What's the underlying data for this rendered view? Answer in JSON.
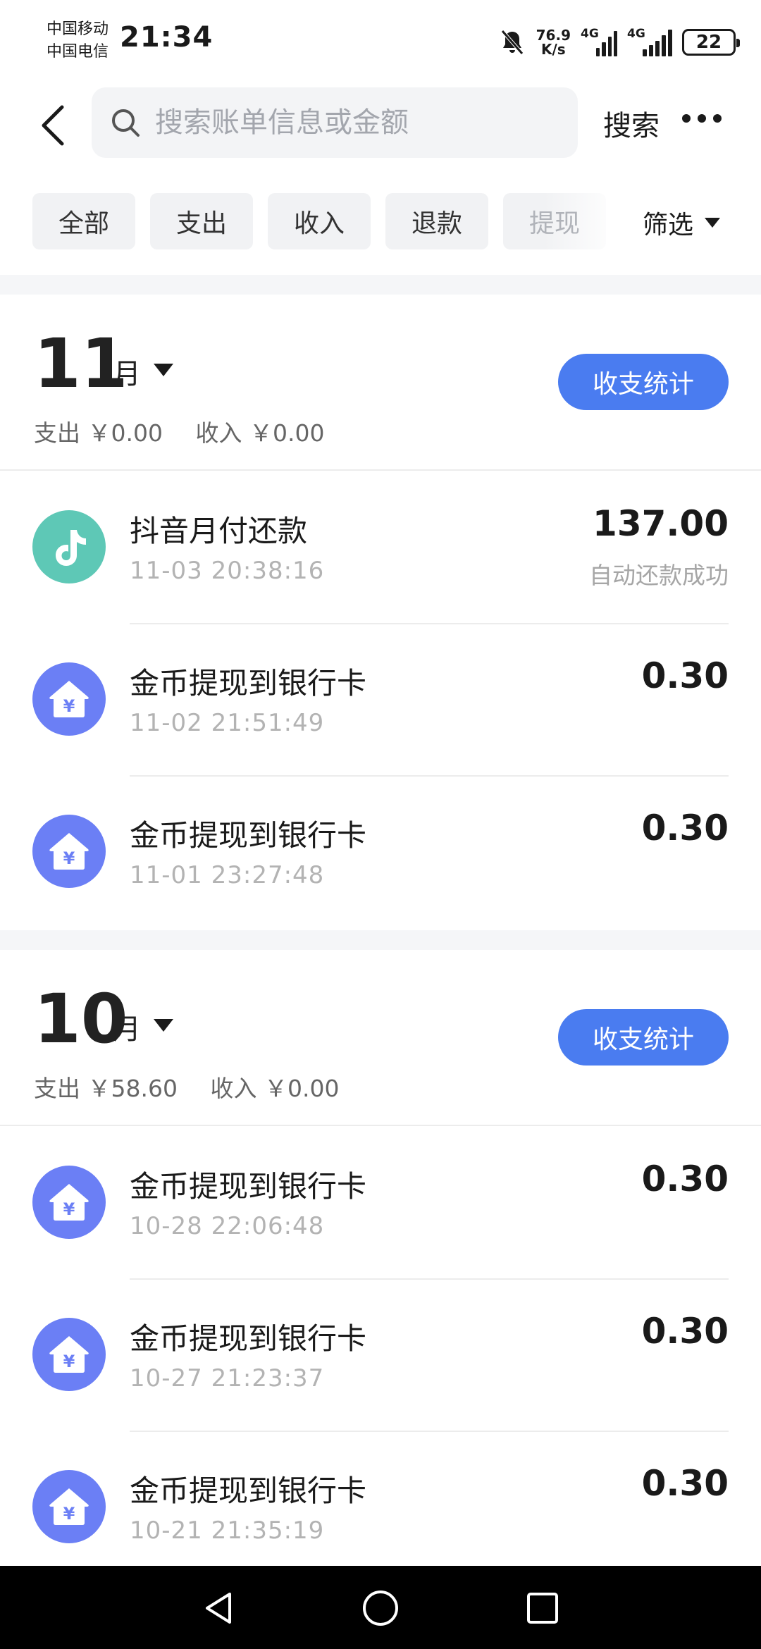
{
  "status": {
    "carrier1": "中国移动",
    "carrier2": "中国电信",
    "time": "21:34",
    "net_speed_value": "76.9",
    "net_speed_unit": "K/s",
    "signal1": "4G",
    "signal2": "4G",
    "battery": "22"
  },
  "header": {
    "search_placeholder": "搜索账单信息或金额",
    "search_label": "搜索"
  },
  "tabs": [
    {
      "label": "全部"
    },
    {
      "label": "支出"
    },
    {
      "label": "收入"
    },
    {
      "label": "退款"
    },
    {
      "label": "提现"
    }
  ],
  "filter_label": "筛选",
  "months": [
    {
      "number": "11",
      "unit": "月",
      "expense_label": "支出",
      "expense": "￥0.00",
      "income_label": "收入",
      "income": "￥0.00",
      "stats_label": "收支统计",
      "transactions": [
        {
          "title": "抖音月付还款",
          "time": "11-03 20:38:16",
          "amount": "137.00",
          "note": "自动还款成功",
          "icon": "douyin-icon",
          "color": "#5ec8b6"
        },
        {
          "title": "金币提现到银行卡",
          "time": "11-02 21:51:49",
          "amount": "0.30",
          "note": "",
          "icon": "coin-house-icon",
          "color": "#6b7ff5"
        },
        {
          "title": "金币提现到银行卡",
          "time": "11-01 23:27:48",
          "amount": "0.30",
          "note": "",
          "icon": "coin-house-icon",
          "color": "#6b7ff5"
        }
      ]
    },
    {
      "number": "10",
      "unit": "月",
      "expense_label": "支出",
      "expense": "￥58.60",
      "income_label": "收入",
      "income": "￥0.00",
      "stats_label": "收支统计",
      "transactions": [
        {
          "title": "金币提现到银行卡",
          "time": "10-28 22:06:48",
          "amount": "0.30",
          "note": "",
          "icon": "coin-house-icon",
          "color": "#6b7ff5"
        },
        {
          "title": "金币提现到银行卡",
          "time": "10-27 21:23:37",
          "amount": "0.30",
          "note": "",
          "icon": "coin-house-icon",
          "color": "#6b7ff5"
        },
        {
          "title": "金币提现到银行卡",
          "time": "10-21 21:35:19",
          "amount": "0.30",
          "note": "",
          "icon": "coin-house-icon",
          "color": "#6b7ff5"
        }
      ]
    }
  ]
}
